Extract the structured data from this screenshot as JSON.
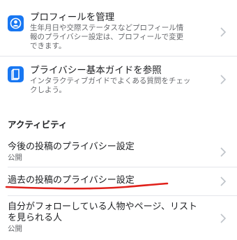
{
  "manage_profile": {
    "title": "プロフィールを管理",
    "desc_line1": "生年月日や交際ステータスなどプロフィール情",
    "desc_line2": "報のプライバシー設定は、プロフィールで変更",
    "desc_line3": "できます。",
    "icon": "profile-icon"
  },
  "privacy_guide": {
    "title": "プライバシー基本ガイドを参照",
    "desc_line1": "インタラクティブガイドでよくある質問をチェッ",
    "desc_line2": "クしよう。",
    "icon": "guide-book-icon"
  },
  "activity": {
    "section_title": "アクティビティ",
    "items": [
      {
        "title": "今後の投稿のプライバシー設定",
        "value": "公開"
      },
      {
        "title": "過去の投稿のプライバシー設定",
        "value": ""
      },
      {
        "title_line1": "自分がフォローしている人物やページ、リスト",
        "title_line2": "を見られる人",
        "value": "公開"
      }
    ]
  },
  "colors": {
    "accent": "#1877f2",
    "annotation": "#e0201a"
  }
}
